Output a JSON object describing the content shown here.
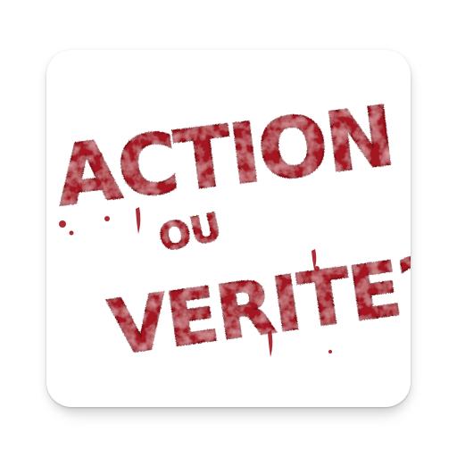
{
  "app_icon": {
    "title_line1": "ACTION",
    "title_line2": "OU",
    "title_line3": "VERITE?",
    "colors": {
      "tile_background": "#ffffff",
      "ink_red": "#a31621",
      "ink_dark_red": "#7f0f17",
      "ink_highlight": "#d8797d"
    }
  }
}
